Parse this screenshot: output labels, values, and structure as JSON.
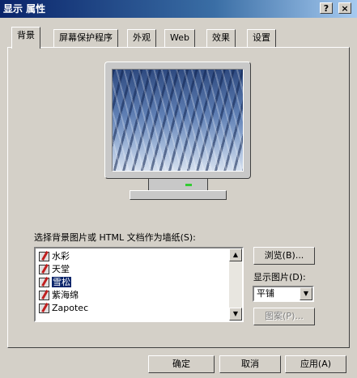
{
  "window": {
    "title": "显示 属性",
    "help_button": "?",
    "close_button": "×"
  },
  "tabs": [
    {
      "label": "背景",
      "active": true
    },
    {
      "label": "屏幕保护程序"
    },
    {
      "label": "外观"
    },
    {
      "label": "Web"
    },
    {
      "label": "效果"
    },
    {
      "label": "设置"
    }
  ],
  "background": {
    "list_label": "选择背景图片或 HTML 文档作为墙纸(S):",
    "wallpapers": [
      {
        "label": "水彩"
      },
      {
        "label": "天堂"
      },
      {
        "label": "雪松",
        "selected": true
      },
      {
        "label": "紫海绵"
      },
      {
        "label": "Zapotec"
      }
    ],
    "browse_button": "浏览(B)...",
    "display_label": "显示图片(D):",
    "display_value": "平铺",
    "pattern_button": "图案(P)..."
  },
  "footer": {
    "ok_button": "确定",
    "cancel_button": "取消",
    "apply_button": "应用(A)"
  },
  "colors": {
    "titlebar": "#0a246a",
    "selection": "#0a246a",
    "dialog_face": "#d4d0c8"
  }
}
